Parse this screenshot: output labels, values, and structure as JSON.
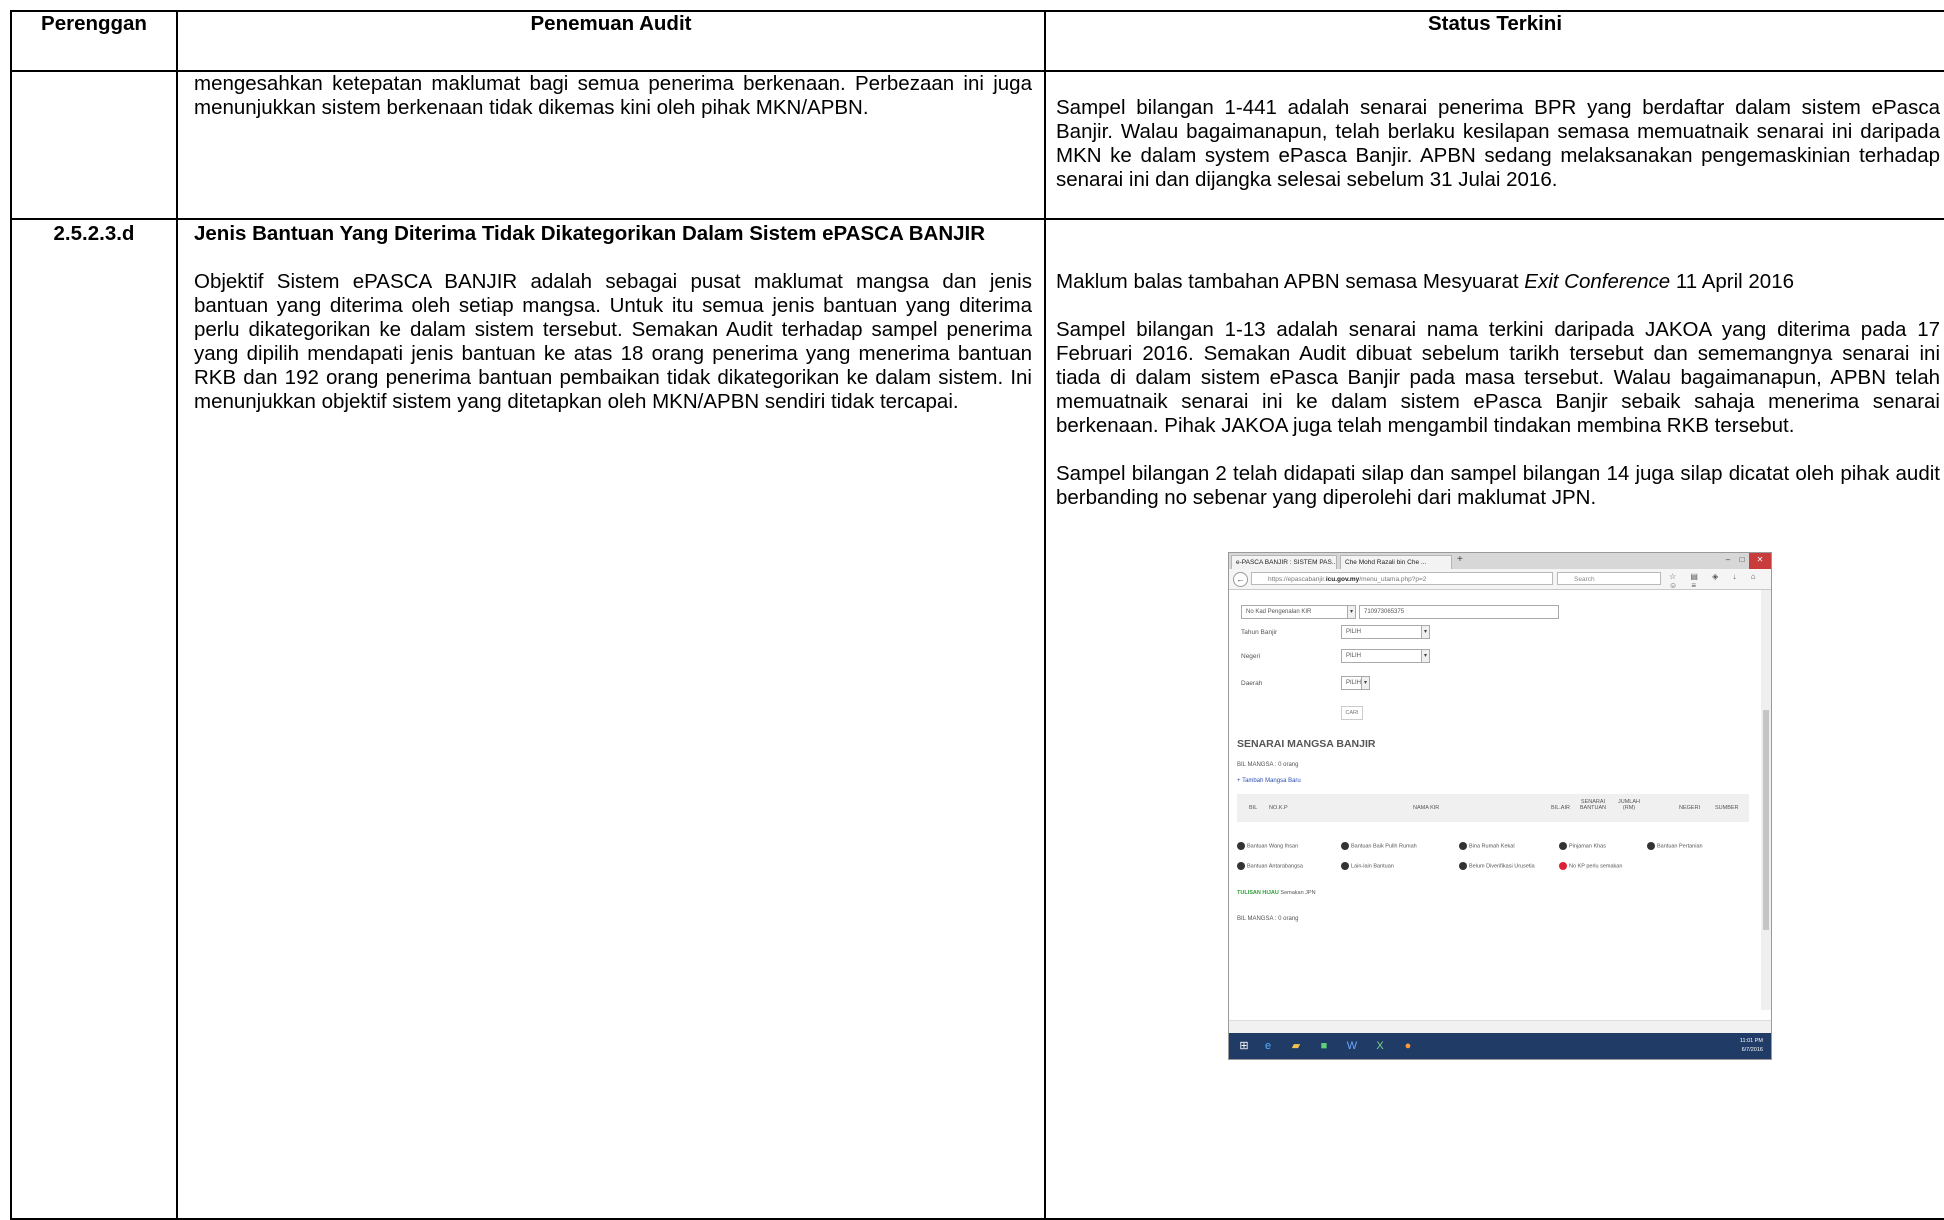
{
  "header": {
    "col1": "Perenggan",
    "col2": "Penemuan Audit",
    "col3": "Status Terkini"
  },
  "row1": {
    "finding": "mengesahkan ketepatan maklumat bagi semua penerima berkenaan. Perbezaan ini juga menunjukkan sistem berkenaan tidak dikemas kini oleh pihak MKN/APBN.",
    "status": "Sampel bilangan 1-441 adalah senarai penerima BPR yang berdaftar dalam sistem ePasca Banjir. Walau bagaimanapun, telah berlaku kesilapan semasa memuatnaik senarai ini daripada MKN ke dalam system ePasca Banjir. APBN sedang melaksanakan pengemaskinian terhadap senarai ini dan dijangka selesai sebelum 31 Julai 2016."
  },
  "row2": {
    "paragraph": "2.5.2.3.d",
    "finding_title": "Jenis Bantuan Yang Diterima Tidak Dikategorikan Dalam Sistem ePASCA BANJIR",
    "finding_body": "Objektif Sistem ePASCA BANJIR adalah sebagai pusat maklumat mangsa dan jenis bantuan yang diterima oleh setiap mangsa. Untuk itu semua jenis bantuan yang diterima perlu dikategorikan ke dalam sistem tersebut. Semakan Audit terhadap sampel penerima yang dipilih mendapati jenis bantuan ke atas 18 orang penerima yang menerima bantuan RKB dan 192 orang penerima bantuan pembaikan tidak dikategorikan ke dalam sistem. Ini menunjukkan objektif sistem yang ditetapkan oleh MKN/APBN sendiri tidak tercapai.",
    "status_intro_a": "Maklum balas tambahan APBN semasa Mesyuarat ",
    "status_intro_em": "Exit Conference",
    "status_intro_b": " 11 April 2016",
    "status_p2": "Sampel bilangan 1-13 adalah senarai nama terkini daripada JAKOA yang diterima pada 17 Februari 2016. Semakan Audit dibuat sebelum tarikh tersebut dan sememangnya senarai ini tiada di dalam sistem ePasca Banjir pada masa tersebut. Walau bagaimanapun, APBN telah memuatnaik senarai ini ke dalam sistem ePasca Banjir sebaik sahaja menerima senarai berkenaan. Pihak JAKOA juga telah mengambil tindakan membina RKB tersebut.",
    "status_p3": "Sampel bilangan 2 telah didapati silap dan sampel bilangan 14 juga silap dicatat oleh pihak audit berbanding no sebenar yang diperolehi dari maklumat JPN."
  },
  "screenshot": {
    "tab1": "e-PASCA BANJIR : SISTEM PAS...",
    "tab2": "Che Mohd Razali bin Che ...",
    "url_a": "https://epascabanjir.",
    "url_b": "icu.gov.my",
    "url_c": "/menu_utama.php?p=2",
    "search": "Search",
    "id_type": "No Kad Pengenalan KIR",
    "id_value": "710973065375",
    "label_tahun": "Tahun Banjir",
    "label_negeri": "Negeri",
    "label_daerah": "Daerah",
    "pilih": "PILIH",
    "cari": "CARI",
    "heading": "SENARAI MANGSA BANJIR",
    "bil_mangsa": "BIL MANGSA : 0 orang",
    "tambah": "+ Tambah Mangsa Baru",
    "th_bil": "BIL",
    "th_nokp": "NO.K.P",
    "th_nama": "NAMA KIR",
    "th_bilair": "BIL.AIR",
    "th_senarai": "SENARAI BANTUAN",
    "th_jumlah": "JUMLAH (RM)",
    "th_negeri": "NEGERI",
    "th_sumber": "SUMBER",
    "lg1": "Bantuan Wang Ihsan",
    "lg2": "Bantuan Baik Pulih Rumah",
    "lg3": "Bina Rumah Kekal",
    "lg4": "Pinjaman Khas",
    "lg5": "Bantuan Pertanian",
    "lg6": "Bantuan Antarabangsa",
    "lg7": "Lain-lain Bantuan",
    "lg8": "Belum Diverifikasi Urusetia",
    "lg9": "No KP perlu semakan",
    "tulisan_b": "TULISAN HIJAU",
    "tulisan_r": " Semakan JPN",
    "bil_mangsa2": "BIL MANGSA : 0 orang",
    "time": "11:01 PM",
    "date": "6/7/2016"
  }
}
